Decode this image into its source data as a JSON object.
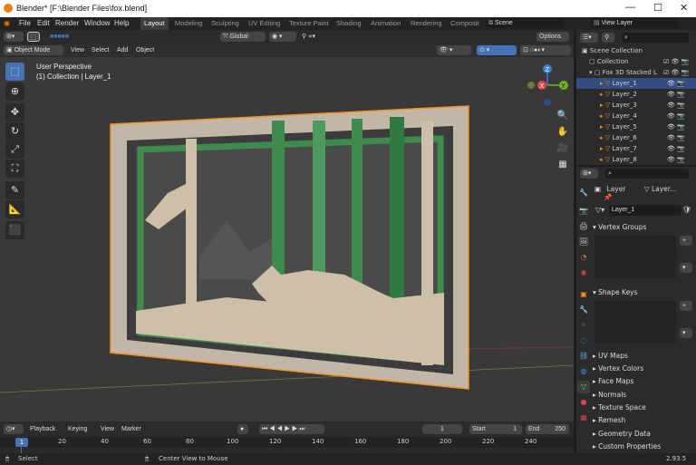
{
  "window": {
    "title": "Blender* [F:\\Blender Files\\fox.blend]",
    "min": "—",
    "max": "☐",
    "close": "✕"
  },
  "menus": [
    "File",
    "Edit",
    "Render",
    "Window",
    "Help"
  ],
  "workspaces": [
    "Layout",
    "Modeling",
    "Sculpting",
    "UV Editing",
    "Texture Paint",
    "Shading",
    "Animation",
    "Rendering",
    "Composit"
  ],
  "scene": "Scene",
  "view_layer": "View Layer",
  "viewport": {
    "transform": "Global",
    "options": "Options",
    "mode": "Object Mode",
    "menu": [
      "View",
      "Select",
      "Add",
      "Object"
    ],
    "overlay_title": "User Perspective",
    "overlay_sub": "(1) Collection | Layer_1",
    "gizmo": {
      "x": "X",
      "y": "Y",
      "z": "Z"
    },
    "colors": {
      "bg": "#393939",
      "x_axis": "#e0484e",
      "y_axis": "#75b020",
      "z_axis": "#3d7be0",
      "select": "#f29224"
    }
  },
  "outliner": {
    "root": "Scene Collection",
    "items": [
      {
        "label": "Collection"
      },
      {
        "label": "Fox 3D Stacked L"
      },
      {
        "label": "Layer_1"
      },
      {
        "label": "Layer_2"
      },
      {
        "label": "Layer_3"
      },
      {
        "label": "Layer_4"
      },
      {
        "label": "Layer_5"
      },
      {
        "label": "Layer_6"
      },
      {
        "label": "Layer_7"
      },
      {
        "label": "Layer_8"
      }
    ]
  },
  "properties": {
    "object": "Layer",
    "data": "Layer...",
    "mesh_name": "Layer_1",
    "sections": [
      "Vertex Groups",
      "Shape Keys",
      "UV Maps",
      "Vertex Colors",
      "Face Maps",
      "Normals",
      "Texture Space",
      "Remesh",
      "Geometry Data",
      "Custom Properties"
    ]
  },
  "timeline": {
    "menu": [
      "Playback",
      "Keying",
      "View",
      "Marker"
    ],
    "current_frame": "1",
    "start_label": "Start",
    "start": "1",
    "end_label": "End",
    "end": "250",
    "ticks": [
      "1",
      "20",
      "40",
      "60",
      "80",
      "100",
      "120",
      "140",
      "160",
      "180",
      "200",
      "220",
      "240"
    ]
  },
  "status": {
    "left": "Select",
    "mid": "Center View to Mouse",
    "version": "2.93.5"
  }
}
